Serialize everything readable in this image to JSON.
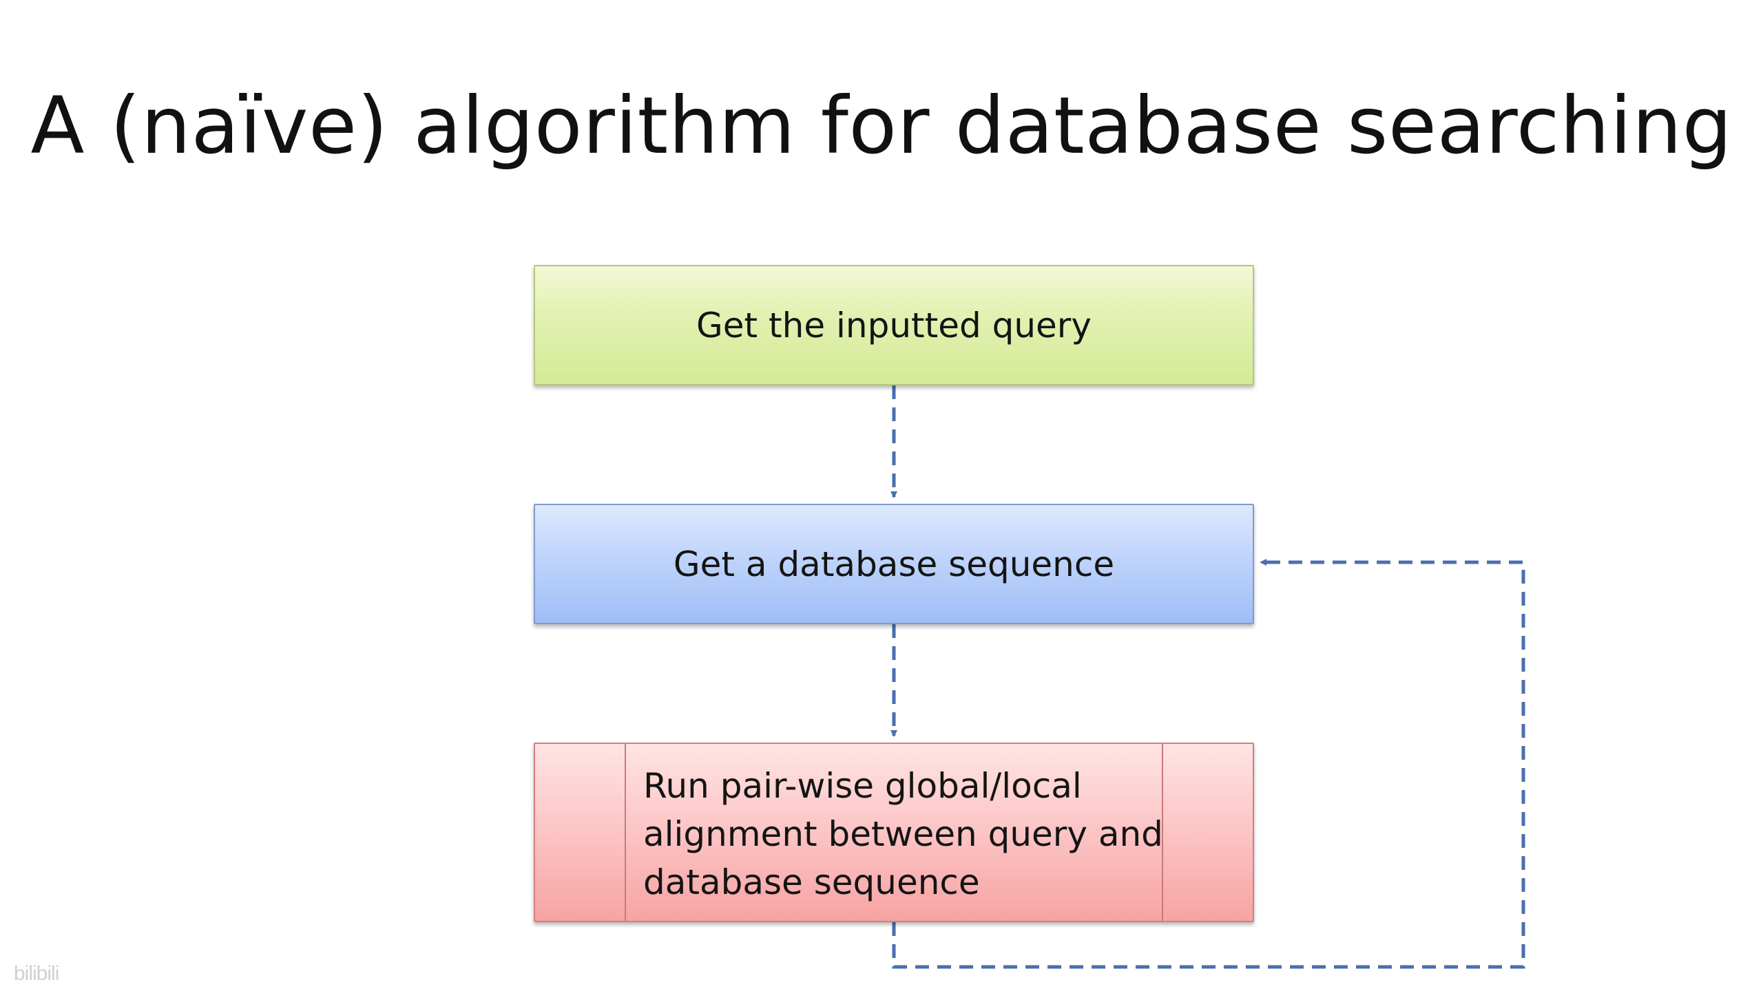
{
  "slide": {
    "title": "A (naïve) algorithm for database searching",
    "watermark": "bilibili"
  },
  "flowchart": {
    "steps": [
      {
        "id": "get-query",
        "label": "Get the inputted query",
        "color": "#d4ea96"
      },
      {
        "id": "get-db-seq",
        "label": "Get a database sequence",
        "color": "#bfd4fb"
      },
      {
        "id": "run-alignment",
        "label": "Run pair-wise global/local alignment between query and database sequence",
        "color": "#fcc4c4",
        "lines": [
          "Run pair-wise global/local",
          "alignment between query and",
          "database sequence"
        ],
        "shape": "predefined-process"
      }
    ],
    "connectors": [
      {
        "from": "get-query",
        "to": "get-db-seq",
        "style": "dashed",
        "color": "#4a6fae"
      },
      {
        "from": "get-db-seq",
        "to": "run-alignment",
        "style": "dashed",
        "color": "#4a6fae"
      },
      {
        "from": "run-alignment",
        "to": "get-db-seq",
        "style": "dashed",
        "color": "#4a6fae",
        "route": "loop-right"
      }
    ]
  }
}
